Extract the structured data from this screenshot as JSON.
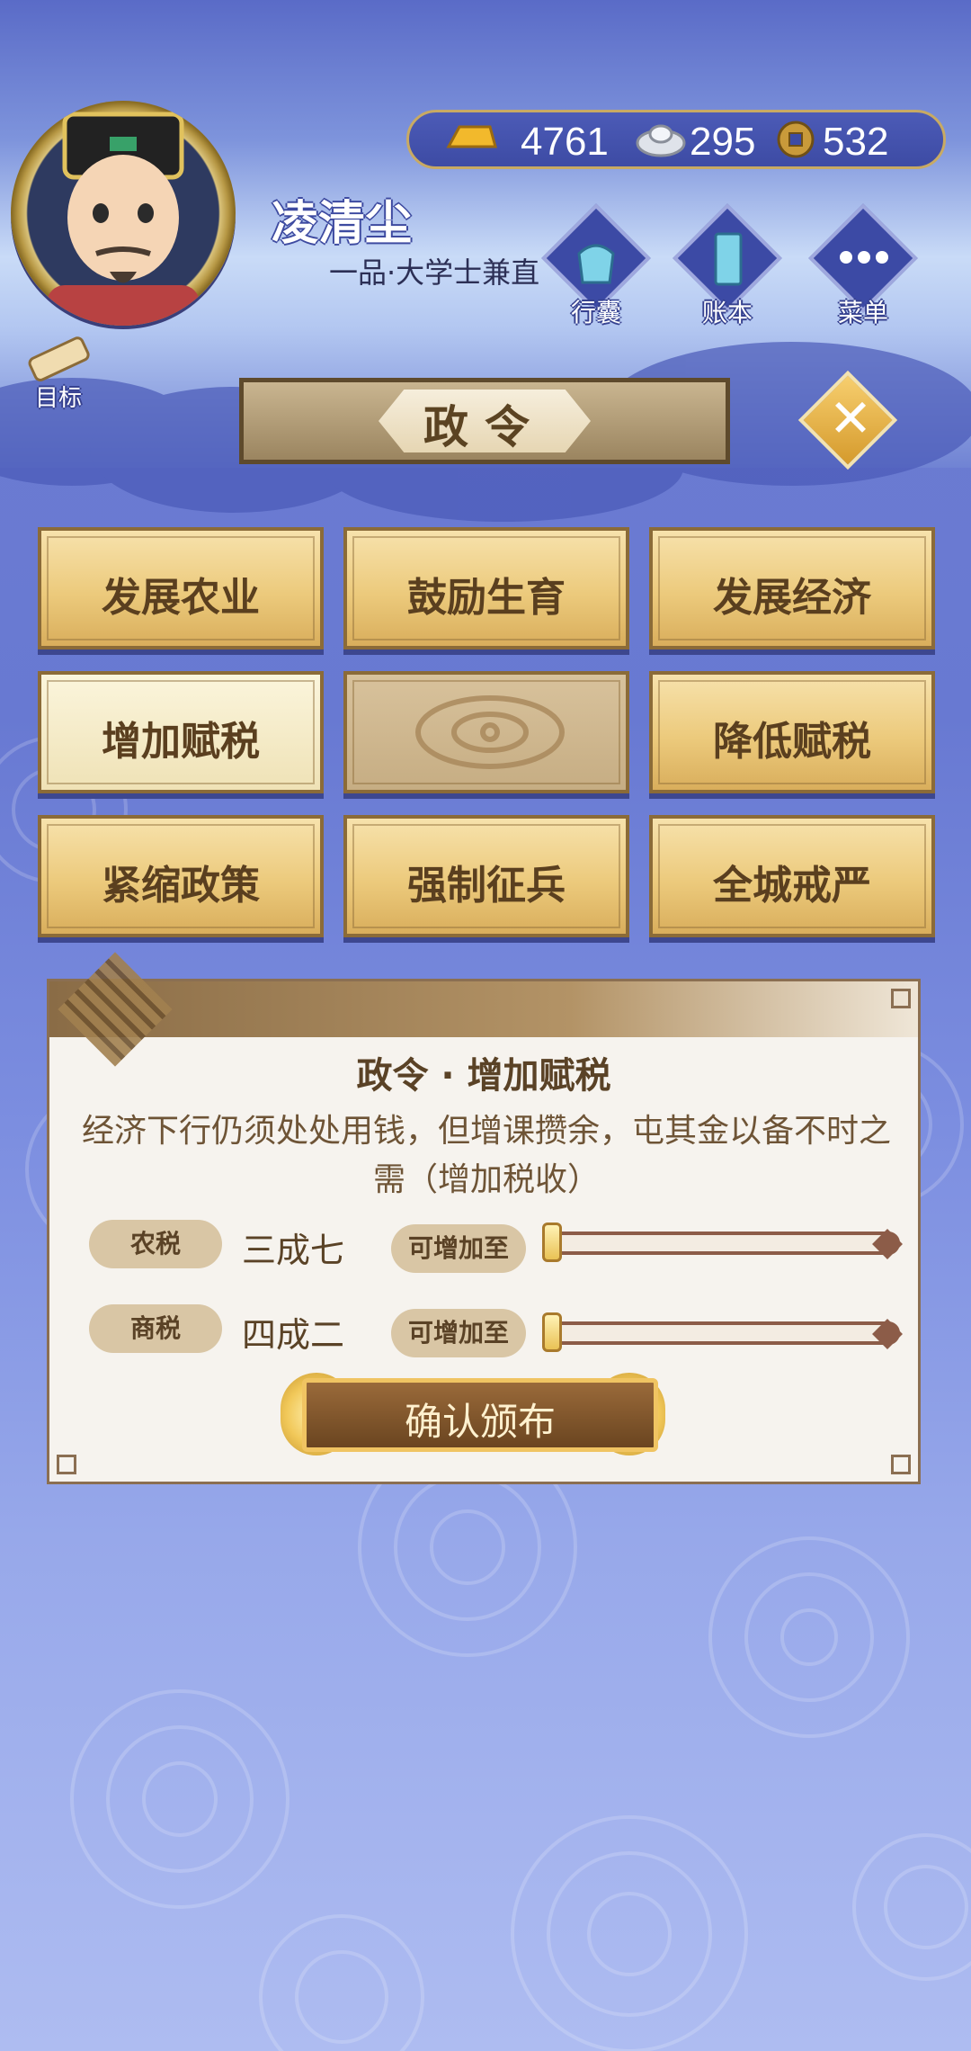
{
  "header": {
    "player_name": "凌清尘",
    "player_rank": "一品·大学士兼直",
    "resources": {
      "gold": "4761",
      "silver": "295",
      "coin": "532"
    },
    "buttons": {
      "bag": "行囊",
      "ledger": "账本",
      "menu": "菜单"
    },
    "goal": "目标"
  },
  "title": "政令",
  "policies": [
    {
      "label": "发展农业"
    },
    {
      "label": "鼓励生育"
    },
    {
      "label": "发展经济"
    },
    {
      "label": "增加赋税"
    },
    {
      "label": ""
    },
    {
      "label": "降低赋税"
    },
    {
      "label": "紧缩政策"
    },
    {
      "label": "强制征兵"
    },
    {
      "label": "全城戒严"
    }
  ],
  "detail": {
    "title": "政令 · 增加赋税",
    "description": "经济下行仍须处处用钱，但增课攒余，屯其金以备不时之需（增加税收）",
    "taxes": [
      {
        "name": "农税",
        "value": "三成七",
        "increase_label": "可增加至",
        "slider_level": 0
      },
      {
        "name": "商税",
        "value": "四成二",
        "increase_label": "可增加至",
        "slider_level": 0
      }
    ],
    "confirm": "确认颁布"
  },
  "colors": {
    "background": "#6f7ed0",
    "button_gold": "#ecca7c",
    "text_brown": "#5a3f1f"
  }
}
